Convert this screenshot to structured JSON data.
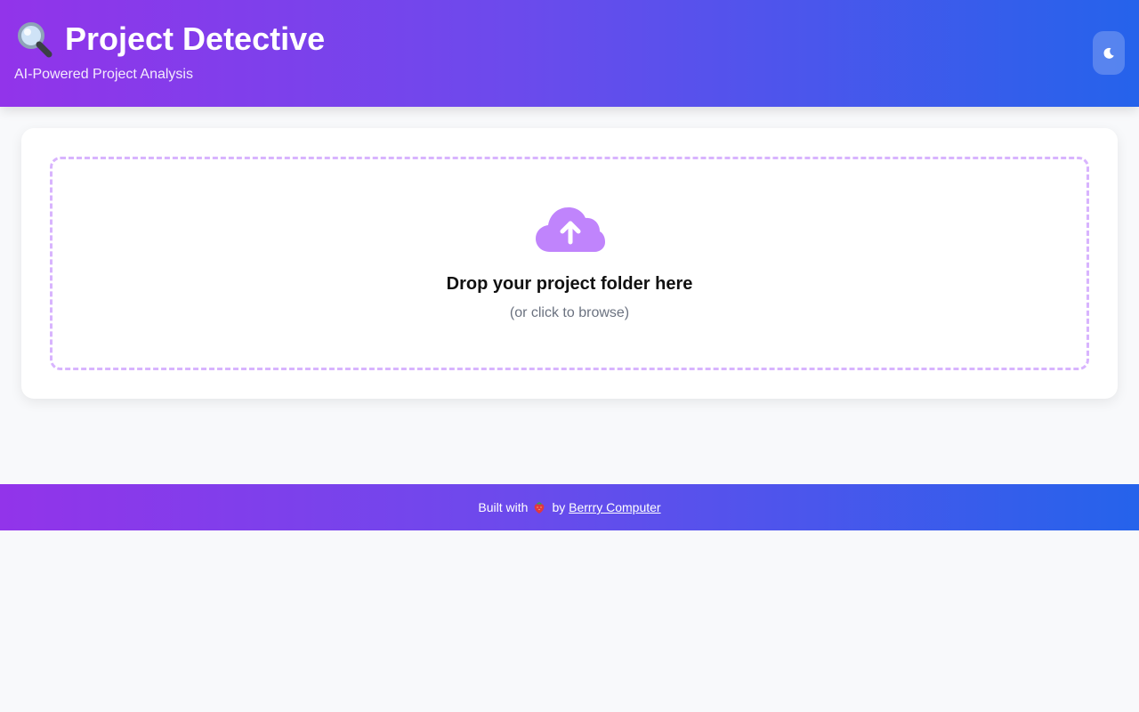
{
  "header": {
    "title": "Project Detective",
    "subtitle": "AI-Powered Project Analysis",
    "title_icon": "magnifying-glass-icon",
    "theme_toggle_icon": "moon-icon"
  },
  "dropzone": {
    "icon": "cloud-upload-icon",
    "title": "Drop your project folder here",
    "subtitle": "(or click to browse)"
  },
  "footer": {
    "prefix": "Built with",
    "emoji_icon": "strawberry-icon",
    "by": "by",
    "link_text": "Berrry Computer"
  },
  "colors": {
    "gradient_start": "#9234ea",
    "gradient_end": "#2563eb",
    "dropzone_border": "#d8b4fe",
    "upload_icon": "#c084fc",
    "page_background": "#f8f9fb"
  }
}
